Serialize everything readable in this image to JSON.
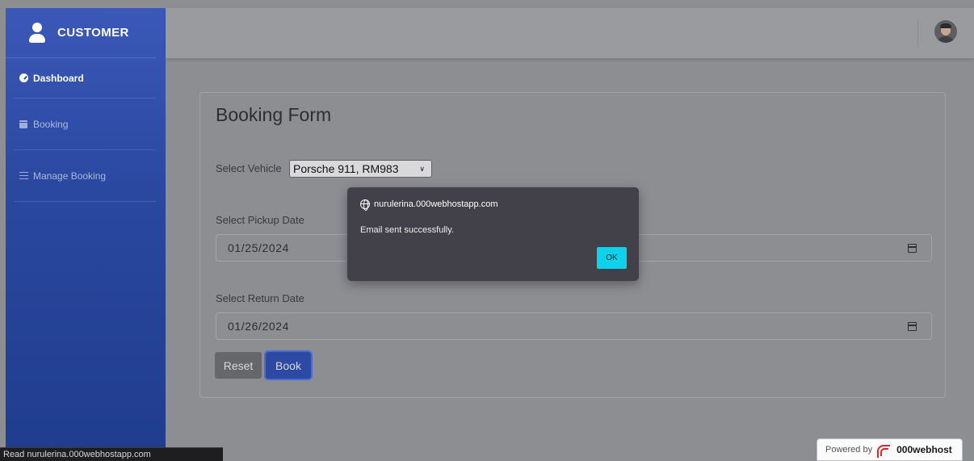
{
  "sidebar": {
    "brand": "CUSTOMER",
    "items": [
      {
        "label": "Dashboard",
        "icon": "dashboard-icon",
        "active": true
      },
      {
        "label": "Booking",
        "icon": "calendar-icon",
        "active": false
      },
      {
        "label": "Manage Booking",
        "icon": "list-icon",
        "active": false
      }
    ]
  },
  "topbar": {
    "avatar": "user-avatar"
  },
  "form": {
    "title": "Booking Form",
    "vehicle_label": "Select Vehicle",
    "vehicle_value": "Porsche 911, RM983",
    "pickup_label": "Select Pickup Date",
    "pickup_value": "01/25/2024",
    "return_label": "Select Return Date",
    "return_value": "01/26/2024",
    "reset_label": "Reset",
    "book_label": "Book"
  },
  "dialog": {
    "origin": "nurulerina.000webhostapp.com",
    "message": "Email sent successfully.",
    "ok_label": "OK"
  },
  "statusbar": {
    "text": "Read nurulerina.000webhostapp.com"
  },
  "powered": {
    "prefix": "Powered by",
    "brand": "000webhost"
  },
  "colors": {
    "sidebar": "#2f4ea8",
    "ok_button": "#0fd2ea",
    "book_button": "#2c49a4"
  }
}
